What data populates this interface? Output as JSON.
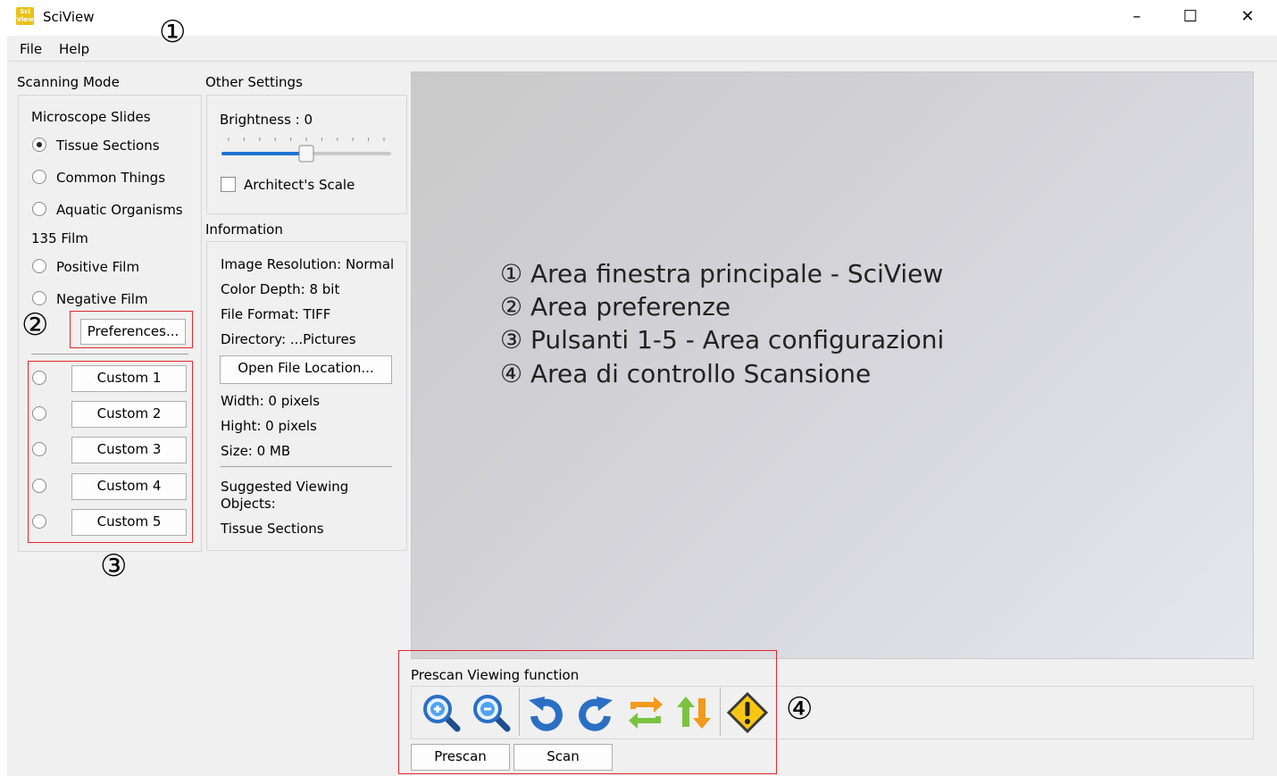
{
  "window": {
    "title": "SciView",
    "icon_text": "Sci View",
    "minimize": "–",
    "maximize": "☐",
    "close": "✕"
  },
  "menu": {
    "file": "File",
    "help": "Help"
  },
  "scanning_mode": {
    "title": "Scanning Mode",
    "microscope_heading": "Microscope Slides",
    "options_microscope": [
      {
        "label": "Tissue Sections",
        "selected": true
      },
      {
        "label": "Common Things",
        "selected": false
      },
      {
        "label": "Aquatic Organisms",
        "selected": false
      }
    ],
    "film_heading": "135 Film",
    "options_film": [
      {
        "label": "Positive Film",
        "selected": false
      },
      {
        "label": "Negative Film",
        "selected": false
      }
    ],
    "preferences_button": "Preferences...",
    "custom_buttons": [
      "Custom 1",
      "Custom 2",
      "Custom 3",
      "Custom 4",
      "Custom 5"
    ]
  },
  "other_settings": {
    "title": "Other Settings",
    "brightness_label": "Brightness : 0",
    "brightness_level": 0.5,
    "architect_scale_label": "Architect's Scale",
    "architect_scale_checked": false
  },
  "information": {
    "title": "Information",
    "image_resolution": "Image Resolution: Normal",
    "color_depth": "Color Depth: 8 bit",
    "file_format": "File Format: TIFF",
    "directory": "Directory: ...Pictures",
    "open_file_location": "Open File Location...",
    "width": "Width: 0 pixels",
    "height": "Hight: 0 pixels",
    "size": "Size: 0 MB",
    "suggested_line1": "Suggested Viewing",
    "suggested_line2": "Objects:",
    "suggested_value": "Tissue Sections"
  },
  "annotations": {
    "lines": [
      "① Area finestra principale - SciView",
      "② Area preferenze",
      "③ Pulsanti 1-5 - Area configurazioni",
      "④ Area di controllo Scansione"
    ],
    "marker_1": "①",
    "marker_2": "②",
    "marker_3": "③",
    "marker_4": "④"
  },
  "prescan": {
    "title": "Prescan Viewing function",
    "tools": [
      "zoom-in-icon",
      "zoom-out-icon",
      "rotate-left-icon",
      "rotate-right-icon",
      "flip-horizontal-icon",
      "flip-vertical-icon",
      "warning-icon"
    ],
    "prescan_button": "Prescan",
    "scan_button": "Scan"
  },
  "colors": {
    "highlight_red": "#e0282e",
    "slider_blue": "#1e73d2",
    "icon_blue": "#2b6fc4",
    "icon_orange": "#f29a1e",
    "icon_green": "#7cc242",
    "warning_yellow": "#f7c613"
  }
}
